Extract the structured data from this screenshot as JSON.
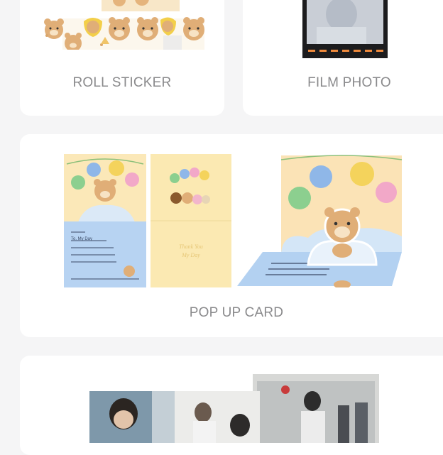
{
  "products": [
    {
      "id": "roll",
      "title": "ROLL STICKER"
    },
    {
      "id": "film",
      "title": "FILM PHOTO"
    },
    {
      "id": "popup",
      "title": "POP UP CARD"
    },
    {
      "id": "photo",
      "title": ""
    }
  ],
  "colors": {
    "page_bg": "#f5f5f6",
    "card_bg": "#ffffff",
    "label": "#8a8a8c",
    "card_yellow": "#fbe8b0",
    "card_blue": "#b8d4f2",
    "bear": "#e3b27a"
  },
  "popup_card": {
    "inner_note_lines": [
      "To. My Day",
      "",
      "",
      ""
    ],
    "front_text": [
      "Thank You",
      "My Day"
    ]
  }
}
